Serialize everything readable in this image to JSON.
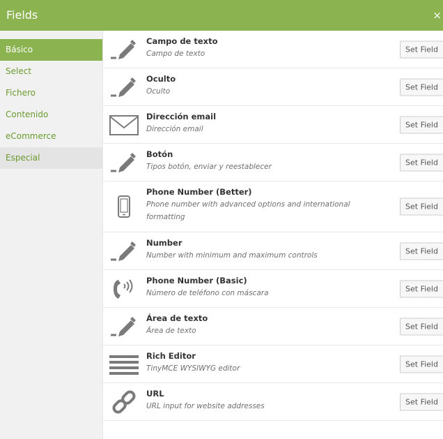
{
  "header": {
    "title": "Fields",
    "close_glyph": "×"
  },
  "sidebar": {
    "items": [
      {
        "label": "Básico"
      },
      {
        "label": "Select"
      },
      {
        "label": "Fichero"
      },
      {
        "label": "Contenido"
      },
      {
        "label": "eCommerce"
      },
      {
        "label": "Especial"
      }
    ]
  },
  "fields": [
    {
      "icon": "pencil-icon",
      "name": "Campo de texto",
      "desc": "Campo de texto",
      "button": "Set Field"
    },
    {
      "icon": "pencil-icon",
      "name": "Oculto",
      "desc": "Oculto",
      "button": "Set Field"
    },
    {
      "icon": "envelope-icon",
      "name": "Dirección email",
      "desc": "Dirección email",
      "button": "Set Field"
    },
    {
      "icon": "pencil-icon",
      "name": "Botón",
      "desc": "Tipos botón, enviar y reestablecer",
      "button": "Set Field"
    },
    {
      "icon": "mobile-phone-icon",
      "name": "Phone Number (Better)",
      "desc": "Phone number with advanced options and international formatting",
      "button": "Set Field"
    },
    {
      "icon": "pencil-icon",
      "name": "Number",
      "desc": "Number with minimum and maximum controls",
      "button": "Set Field"
    },
    {
      "icon": "phone-volume-icon",
      "name": "Phone Number (Basic)",
      "desc": "Número de teléfono con máscara",
      "button": "Set Field"
    },
    {
      "icon": "pencil-icon",
      "name": "Área de texto",
      "desc": "Área de texto",
      "button": "Set Field"
    },
    {
      "icon": "rich-editor-lines-icon",
      "name": "Rich Editor",
      "desc": "TinyMCE WYSIWYG editor",
      "button": "Set Field"
    },
    {
      "icon": "link-chain-icon",
      "name": "URL",
      "desc": "URL input for website addresses",
      "button": "Set Field"
    }
  ],
  "colors": {
    "brand_green": "#8bb34f",
    "sidebar_bg": "#f1f1f1",
    "sidebar_text": "#6b9a2f",
    "icon_gray": "#7a7a7a"
  }
}
